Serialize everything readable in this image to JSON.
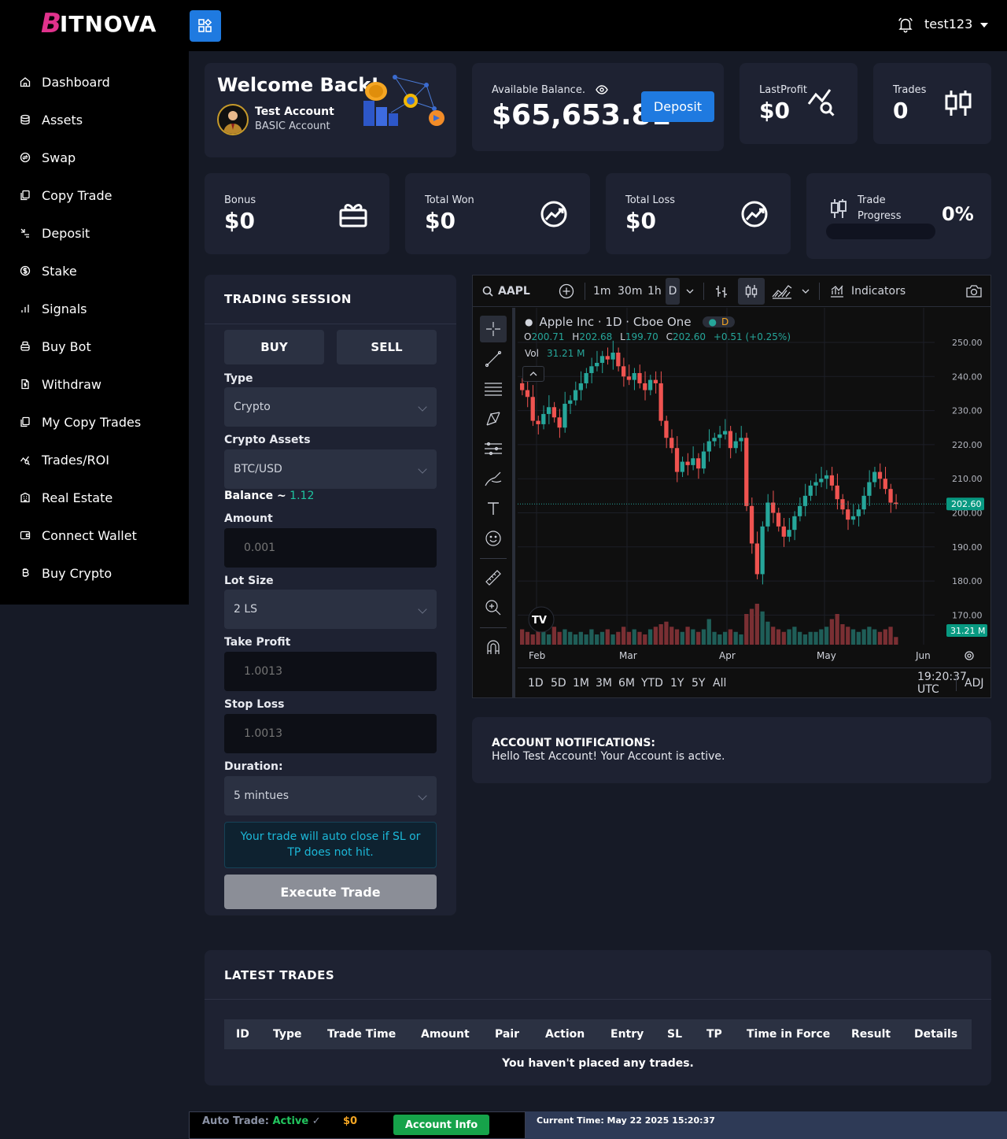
{
  "brand": {
    "logo_b": "B",
    "logo_rest": "ITNOVA"
  },
  "sidebar": {
    "items": [
      {
        "label": "Dashboard",
        "icon": "home-icon"
      },
      {
        "label": "Assets",
        "icon": "database-icon"
      },
      {
        "label": "Swap",
        "icon": "swap-icon"
      },
      {
        "label": "Copy Trade",
        "icon": "copy-icon"
      },
      {
        "label": "Deposit",
        "icon": "deposit-icon"
      },
      {
        "label": "Stake",
        "icon": "dollar-circle-icon"
      },
      {
        "label": "Signals",
        "icon": "signal-bars-icon"
      },
      {
        "label": "Buy Bot",
        "icon": "bot-icon"
      },
      {
        "label": "Withdraw",
        "icon": "file-dollar-icon"
      },
      {
        "label": "My Copy Trades",
        "icon": "copy-icon"
      },
      {
        "label": "Trades/ROI",
        "icon": "chart-search-icon"
      },
      {
        "label": "Real Estate",
        "icon": "building-icon"
      },
      {
        "label": "Connect Wallet",
        "icon": "wallet-icon"
      },
      {
        "label": "Buy Crypto",
        "icon": "bitcoin-icon"
      }
    ]
  },
  "topbar": {
    "username": "test123"
  },
  "welcome": {
    "title": "Welcome Back!",
    "account_name": "Test Account",
    "account_type": "BASIC Account"
  },
  "balance": {
    "label": "Available Balance.",
    "value": "$65,653.81",
    "deposit_label": "Deposit"
  },
  "last_profit": {
    "label": "LastProfit",
    "value": "$0"
  },
  "trades_stat": {
    "label": "Trades",
    "value": "0"
  },
  "bonus": {
    "label": "Bonus",
    "value": "$0"
  },
  "total_won": {
    "label": "Total Won",
    "value": "$0"
  },
  "total_loss": {
    "label": "Total Loss",
    "value": "$0"
  },
  "trade_progress": {
    "label_line1": "Trade",
    "label_line2": "Progress",
    "value": "0%",
    "percent": 0
  },
  "trading_session": {
    "title": "TRADING SESSION",
    "buy_label": "BUY",
    "sell_label": "SELL",
    "type_label": "Type",
    "type_value": "Crypto",
    "assets_label": "Crypto Assets",
    "assets_value": "BTC/USD",
    "balance_label": "Balance ~",
    "balance_value": " 1.12",
    "amount_label": "Amount",
    "amount_placeholder": "0.001",
    "lot_label": "Lot Size",
    "lot_value": "2 LS",
    "tp_label": "Take Profit",
    "tp_placeholder": "1.0013",
    "sl_label": "Stop Loss",
    "sl_placeholder": "1.0013",
    "duration_label": "Duration:",
    "duration_value": "5 mintues",
    "info": "Your trade will auto close if SL or TP does not hit.",
    "execute_label": "Execute Trade"
  },
  "chart_toolbar": {
    "symbol": "AAPL",
    "intervals": [
      "1m",
      "30m",
      "1h",
      "D"
    ],
    "indicators": "Indicators"
  },
  "chart_legend": {
    "title": "Apple Inc · 1D · Cboe One",
    "badge": "D",
    "o_label": "O",
    "o": "200.71",
    "h_label": "H",
    "h": "202.68",
    "l_label": "L",
    "l": "199.70",
    "c_label": "C",
    "c": "202.60",
    "change": "+0.51 (+0.25%)",
    "vol_label": "Vol",
    "vol": "31.21 M"
  },
  "chart_data": {
    "type": "candlestick",
    "symbol": "AAPL",
    "interval": "1D",
    "x_ticks": [
      "Feb",
      "Mar",
      "Apr",
      "May",
      "Jun"
    ],
    "y_ticks": [
      250,
      240,
      230,
      220,
      210,
      200,
      190,
      180,
      170
    ],
    "ylim": [
      166,
      256
    ],
    "last_price_label": "202.60",
    "last_volume_label": "31.21 M",
    "close": [
      236,
      234,
      227,
      226,
      229,
      231,
      228,
      225,
      232,
      233,
      236,
      238,
      241,
      243,
      244,
      246,
      245,
      247,
      243,
      240,
      239,
      241,
      238,
      236,
      239,
      238,
      227,
      222,
      219,
      212,
      215,
      214,
      216,
      213,
      218,
      221,
      222,
      223,
      224,
      219,
      221,
      222,
      202,
      191,
      182,
      196,
      203,
      200,
      196,
      193,
      195,
      199,
      202,
      205,
      208,
      209,
      210,
      211,
      208,
      204,
      201,
      198,
      199,
      201,
      205,
      209,
      212,
      210,
      207,
      203,
      202.6
    ],
    "volume": [
      6,
      5,
      4,
      6,
      5,
      4,
      7,
      5,
      6,
      5,
      4,
      5,
      4,
      6,
      4,
      5,
      6,
      4,
      5,
      7,
      5,
      6,
      5,
      4,
      6,
      7,
      8,
      9,
      7,
      6,
      5,
      7,
      6,
      5,
      6,
      10,
      5,
      4,
      5,
      6,
      5,
      4,
      12,
      14,
      16,
      13,
      9,
      7,
      6,
      5,
      6,
      7,
      5,
      4,
      5,
      5,
      6,
      7,
      10,
      12,
      8,
      7,
      6,
      5,
      6,
      7,
      6,
      5,
      6,
      7,
      3
    ],
    "range_buttons": [
      "1D",
      "5D",
      "1M",
      "3M",
      "6M",
      "YTD",
      "1Y",
      "5Y",
      "All"
    ],
    "time_display": "19:20:37 UTC",
    "adj_label": "ADJ"
  },
  "notifications": {
    "title": "ACCOUNT NOTIFICATIONS:",
    "message": "Hello Test Account! Your Account is active."
  },
  "latest_trades": {
    "title": "LATEST TRADES",
    "columns": [
      "ID",
      "Type",
      "Trade Time",
      "Amount",
      "Pair",
      "Action",
      "Entry",
      "SL",
      "TP",
      "Time in Force",
      "Result",
      "Details"
    ],
    "empty": "You haven't placed any trades."
  },
  "footer": {
    "auto_label": "Auto Trade:",
    "auto_status": "Active",
    "amount": "$0",
    "account_info_label": "Account Info",
    "current_time": "Current Time: May 22 2025 15:20:37"
  },
  "colors": {
    "accent": "#1f7ae0",
    "up": "#26a69a",
    "down": "#ef5350",
    "card": "#1e2232"
  }
}
